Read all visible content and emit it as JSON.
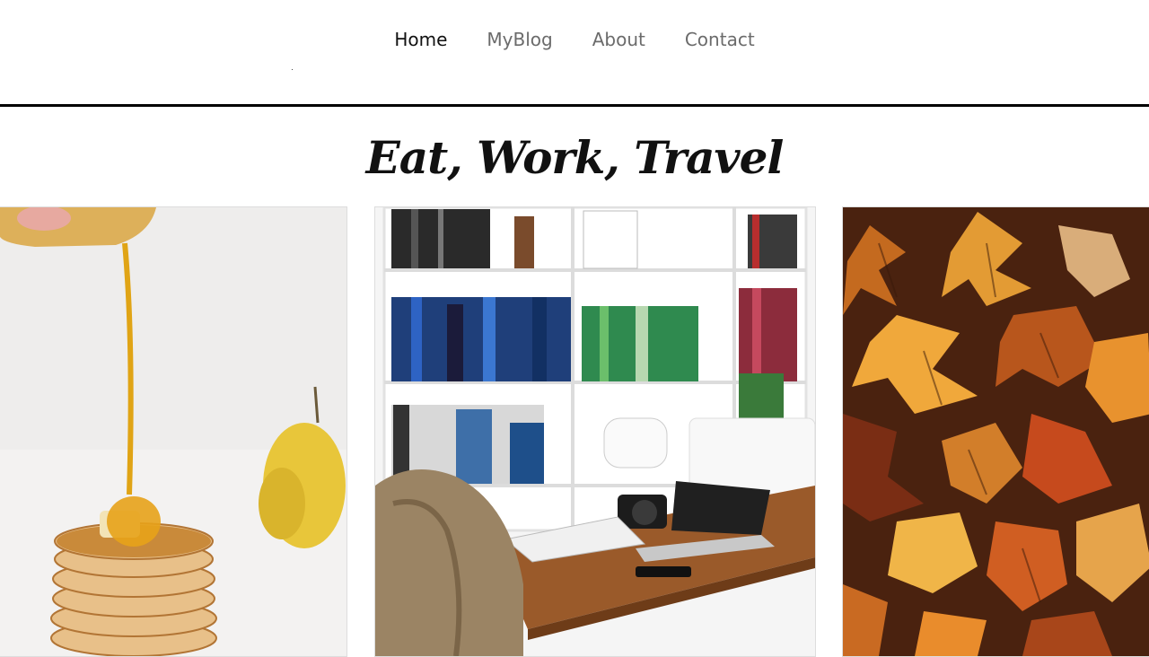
{
  "nav": {
    "items": [
      {
        "label": "Home",
        "active": true
      },
      {
        "label": "MyBlog",
        "active": false
      },
      {
        "label": "About",
        "active": false
      },
      {
        "label": "Contact",
        "active": false
      }
    ]
  },
  "hero": {
    "title": "Eat, Work, Travel"
  },
  "cards": [
    {
      "name": "food",
      "image": "pancakes-honey-photo"
    },
    {
      "name": "work",
      "image": "bookshelf-desk-laptop-photo"
    },
    {
      "name": "travel",
      "image": "autumn-leaves-photo"
    }
  ],
  "colors": {
    "nav_active": "#111111",
    "nav_inactive": "#6b6b6b",
    "divider": "#000000"
  }
}
